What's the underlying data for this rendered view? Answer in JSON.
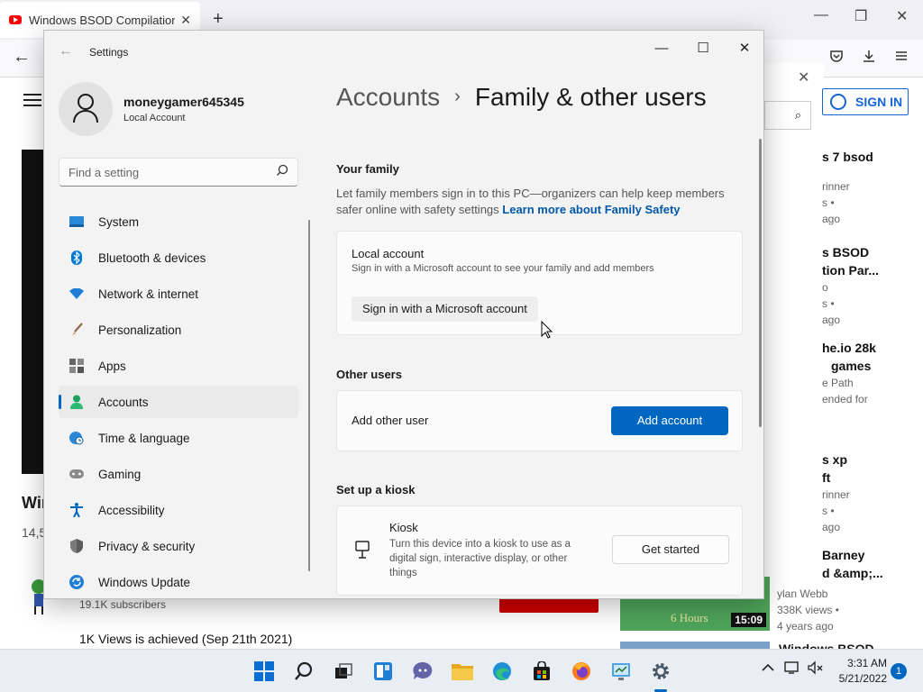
{
  "browser": {
    "tab_title": "Windows BSOD Compilation #",
    "tab_close": "✕",
    "new_tab": "+",
    "minimize": "—",
    "maximize": "❐",
    "close": "✕",
    "back": "←",
    "signin_label": "SIGN IN",
    "search_icon": "⌕",
    "overlay_close": "✕"
  },
  "youtube": {
    "title_fragment": "Wir",
    "views_fragment": "14,5",
    "subscribers": "19.1K subscribers",
    "milestone": "1K Views is achieved (Sep 21th 2021)",
    "recommendations": [
      {
        "title": "s 7 bsod",
        "meta1": "rinner",
        "meta2": "s •",
        "meta3": "ago"
      },
      {
        "title": "s BSOD",
        "title2": "tion Par...",
        "meta1": "o",
        "meta2": "s •",
        "meta3": "ago"
      },
      {
        "title": "he.io 28k",
        "title2": "games",
        "meta1": "e Path",
        "meta2": "ended for"
      },
      {
        "title": "s xp",
        "title2": "ft",
        "meta1": "rinner",
        "meta2": "s •",
        "meta3": "ago"
      },
      {
        "title": "Barney",
        "title2": "d &amp;...",
        "meta1": "ylan Webb",
        "meta2": "338K views •",
        "meta3": "4 years ago"
      }
    ],
    "thumb_duration": "15:09",
    "thumb_overlay": "6 Hours",
    "last_title_fragment": "Windows BSOD"
  },
  "settings": {
    "window_title": "Settings",
    "back": "←",
    "minimize": "—",
    "maximize": "☐",
    "close": "✕",
    "user_name": "moneygamer645345",
    "account_type": "Local Account",
    "find_placeholder": "Find a setting",
    "nav": [
      {
        "label": "System",
        "icon": "monitor-icon",
        "color": "#0078d4"
      },
      {
        "label": "Bluetooth & devices",
        "icon": "bluetooth-icon",
        "color": "#0078d4"
      },
      {
        "label": "Network & internet",
        "icon": "wifi-icon",
        "color": "#0078d4"
      },
      {
        "label": "Personalization",
        "icon": "brush-icon",
        "color": "#c88a3c"
      },
      {
        "label": "Apps",
        "icon": "apps-icon",
        "color": "#555555"
      },
      {
        "label": "Accounts",
        "icon": "person-icon",
        "color": "#1aa260"
      },
      {
        "label": "Time & language",
        "icon": "globe-clock-icon",
        "color": "#0078d4"
      },
      {
        "label": "Gaming",
        "icon": "gamepad-icon",
        "color": "#777777"
      },
      {
        "label": "Accessibility",
        "icon": "accessibility-icon",
        "color": "#0067c0"
      },
      {
        "label": "Privacy & security",
        "icon": "shield-icon",
        "color": "#777777"
      },
      {
        "label": "Windows Update",
        "icon": "update-icon",
        "color": "#0078d4"
      }
    ],
    "breadcrumb_parent": "Accounts",
    "breadcrumb_sep": "›",
    "breadcrumb_current": "Family & other users",
    "your_family_title": "Your family",
    "your_family_desc": "Let family members sign in to this PC—organizers can help keep members safer online with safety settings",
    "learn_more": "Learn more about Family Safety",
    "local_title": "Local account",
    "local_desc": "Sign in with a Microsoft account to see your family and add members",
    "ms_signin_button": "Sign in with a Microsoft account",
    "other_users_title": "Other users",
    "add_other_user": "Add other user",
    "add_account_button": "Add account",
    "kiosk_section_title": "Set up a kiosk",
    "kiosk_title": "Kiosk",
    "kiosk_desc": "Turn this device into a kiosk to use as a digital sign, interactive display, or other things",
    "get_started_button": "Get started"
  },
  "taskbar": {
    "time": "3:31 AM",
    "date": "5/21/2022",
    "notifications": "1",
    "tray_chevron": "^"
  },
  "colors": {
    "accent": "#0067c0",
    "youtube_red": "#ff0000"
  }
}
